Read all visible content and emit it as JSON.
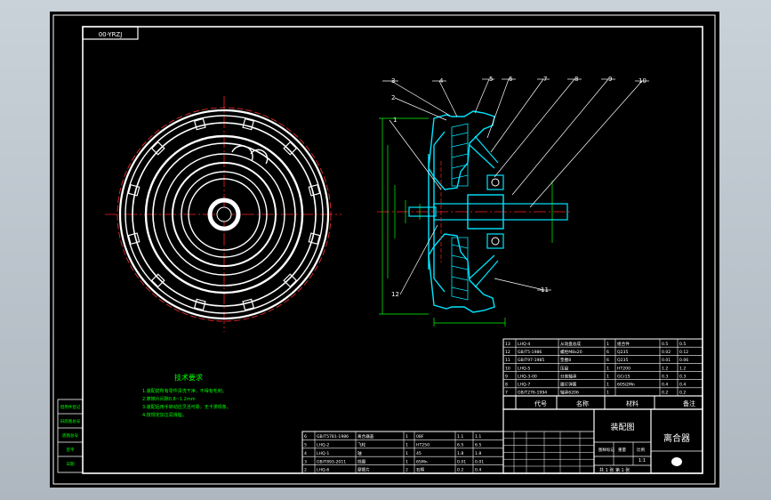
{
  "drawing_code": "00-YRZJ",
  "title_block": {
    "drawing_name": "装配图",
    "part_name": "离合器",
    "header_cols": [
      "代号",
      "名称",
      "材料",
      "备注"
    ],
    "scale_text": "1:1",
    "sheet_text": "共 1 张 第 1 张",
    "fields": [
      "图样标记",
      "重量",
      "比例"
    ]
  },
  "tech_requirements": {
    "heading": "技术要求",
    "lines": [
      "1.装配前所有零件清洗干净，不得有毛刺。",
      "2.摩擦片间隙0.8~1.2mm",
      "3.装配后用手转动应灵活可靠，无卡滞现象。",
      "4.按规定加注润滑脂。"
    ]
  },
  "part_labels": [
    "1",
    "2",
    "3",
    "4",
    "5",
    "6",
    "7",
    "8",
    "9",
    "10",
    "11",
    "12"
  ],
  "bom_upper": [
    [
      "13",
      "LHQ-4",
      "从动盘总成",
      "1",
      "组合件",
      "0.5",
      "0.5"
    ],
    [
      "12",
      "GB/T5-1986",
      "螺栓M8x20",
      "6",
      "Q235",
      "0.02",
      "0.12"
    ],
    [
      "11",
      "GB/T97-1985",
      "垫圈8",
      "6",
      "Q235",
      "0.01",
      "0.06"
    ],
    [
      "10",
      "LHQ-5",
      "压盘",
      "1",
      "HT200",
      "1.2",
      "1.2"
    ],
    [
      "9",
      "LHQ-3-00",
      "分离轴承",
      "1",
      "GCr15",
      "0.3",
      "0.3"
    ],
    [
      "8",
      "LHQ-7",
      "膜片弹簧",
      "1",
      "60Si2Mn",
      "0.4",
      "0.4"
    ],
    [
      "7",
      "GB/T276-1994",
      "轴承6206",
      "1",
      "",
      "0.2",
      "0.2"
    ]
  ],
  "bom_lower": [
    [
      "6",
      "GB/T5781-1986",
      "离合器盖",
      "1",
      "08F",
      "1.1",
      "1.1"
    ],
    [
      "5",
      "LHQ-2",
      "飞轮",
      "1",
      "HT250",
      "6.5",
      "6.5"
    ],
    [
      "4",
      "LHQ-1",
      "轴",
      "1",
      "45",
      "1.8",
      "1.8"
    ],
    [
      "3",
      "GB/T893-2011",
      "挡圈",
      "1",
      "65Mn",
      "0.01",
      "0.01"
    ],
    [
      "2",
      "LHQ-6",
      "摩擦片",
      "2",
      "石棉",
      "0.2",
      "0.4"
    ]
  ],
  "left_stamp": [
    "借用件登记",
    "旧底图总号",
    "底图总号",
    "签字",
    "日期"
  ],
  "colors": {
    "background": "#000000",
    "frame": "#ffffff",
    "section": "#00e5ff",
    "centerline": "#ff2020",
    "text": "#00ff00",
    "leader": "#ffffff"
  }
}
